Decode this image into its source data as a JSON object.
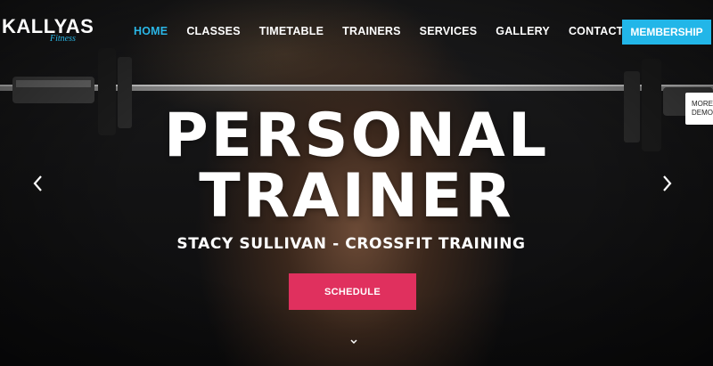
{
  "logo": {
    "name": "KALLYAS",
    "tagline": "Fitness"
  },
  "nav": {
    "items": [
      {
        "label": "HOME",
        "active": true
      },
      {
        "label": "CLASSES",
        "active": false
      },
      {
        "label": "TIMETABLE",
        "active": false
      },
      {
        "label": "TRAINERS",
        "active": false
      },
      {
        "label": "SERVICES",
        "active": false
      },
      {
        "label": "GALLERY",
        "active": false
      },
      {
        "label": "CONTACT US",
        "active": false
      }
    ]
  },
  "membership_label": "MEMBERSHIP",
  "more_demos": {
    "line1": "MORE",
    "line2": "DEMOS"
  },
  "hero": {
    "title_line1": "PERSONAL",
    "title_line2": "TRAINER",
    "subtitle": "STACY SULLIVAN - CROSSFIT TRAINING",
    "cta_label": "SCHEDULE"
  },
  "icons": {
    "prev": "chevron-left-icon",
    "next": "chevron-right-icon",
    "scroll": "chevron-down-icon"
  },
  "colors": {
    "accent": "#22b6e8",
    "cta": "#e0305e",
    "text": "#ffffff"
  }
}
